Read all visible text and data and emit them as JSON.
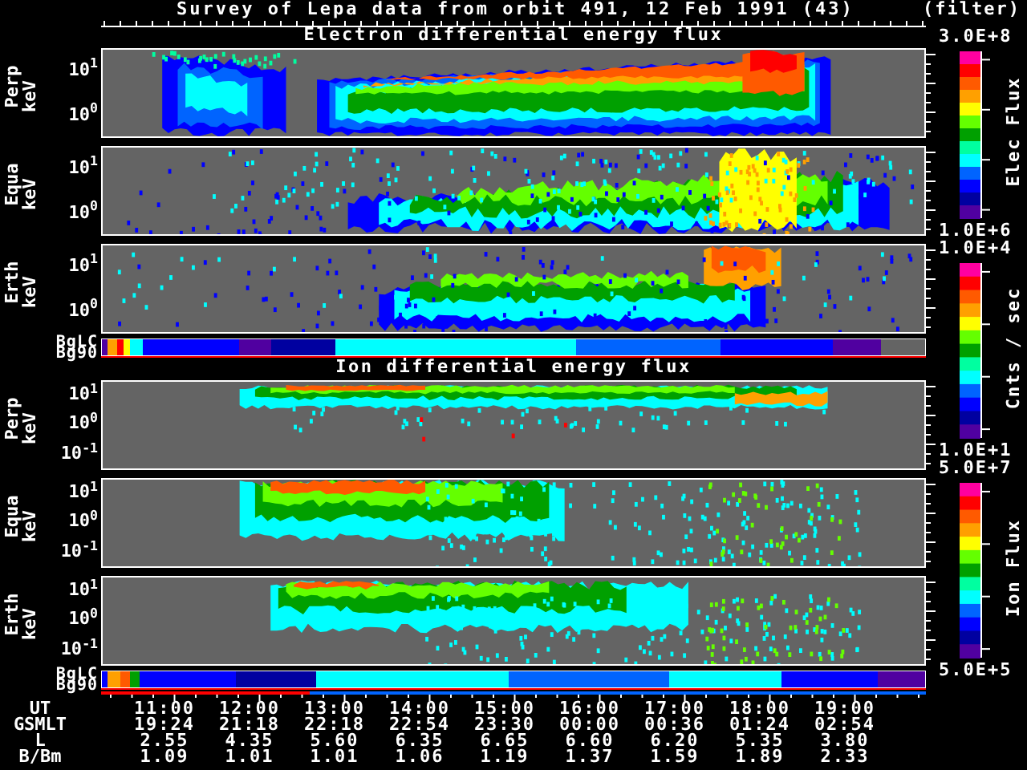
{
  "title": "Survey of Lepa data from orbit 491, 12 Feb 1991 (43)",
  "mode": "(filter)",
  "sections": [
    {
      "title": "Electron differential energy flux",
      "panels": [
        {
          "label": [
            "Perp",
            "keV"
          ],
          "ticks": [
            "10$^{1}$",
            "10$^{0}$"
          ]
        },
        {
          "label": [
            "Equa",
            "keV"
          ],
          "ticks": [
            "10$^{1}$",
            "10$^{0}$"
          ]
        },
        {
          "label": [
            "Erth",
            "keV"
          ],
          "ticks": [
            "10$^{1}$",
            "10$^{0}$"
          ]
        }
      ],
      "background_labels": [
        "BgLC",
        "Bg90"
      ]
    },
    {
      "title": "Ion differential energy flux",
      "panels": [
        {
          "label": [
            "Perp",
            "keV"
          ],
          "ticks": [
            "10$^{1}$",
            "10$^{0}$",
            "10$^{-1}$"
          ]
        },
        {
          "label": [
            "Equa",
            "keV"
          ],
          "ticks": [
            "10$^{1}$",
            "10$^{0}$",
            "10$^{-1}$"
          ]
        },
        {
          "label": [
            "Erth",
            "keV"
          ],
          "ticks": [
            "10$^{1}$",
            "10$^{0}$",
            "10$^{-1}$"
          ]
        }
      ],
      "background_labels": [
        "BgLC",
        "Bg90"
      ]
    }
  ],
  "colorbars": [
    {
      "top": "3.0E+8",
      "bottom": "1.0E+6",
      "caption": "Elec Flux"
    },
    {
      "top": "1.0E+4",
      "bottom": "1.0E+1",
      "caption": "Cnts / sec"
    },
    {
      "top": "5.0E+7",
      "bottom": "5.0E+5",
      "caption": "Ion Flux"
    }
  ],
  "axis_rows": [
    {
      "label": "UT",
      "values": [
        "11:00",
        "12:00",
        "13:00",
        "14:00",
        "15:00",
        "16:00",
        "17:00",
        "18:00",
        "19:00"
      ]
    },
    {
      "label": "GSMLT",
      "values": [
        "19:24",
        "21:18",
        "22:18",
        "22:54",
        "23:30",
        "00:00",
        "00:36",
        "01:24",
        "02:54"
      ]
    },
    {
      "label": "L",
      "values": [
        "2.55",
        "4.35",
        "5.60",
        "6.35",
        "6.65",
        "6.60",
        "6.20",
        "5.35",
        "3.80"
      ]
    },
    {
      "label": "B/Bm",
      "values": [
        "1.09",
        "1.01",
        "1.01",
        "1.06",
        "1.19",
        "1.37",
        "1.59",
        "1.89",
        "2.33"
      ]
    }
  ]
}
